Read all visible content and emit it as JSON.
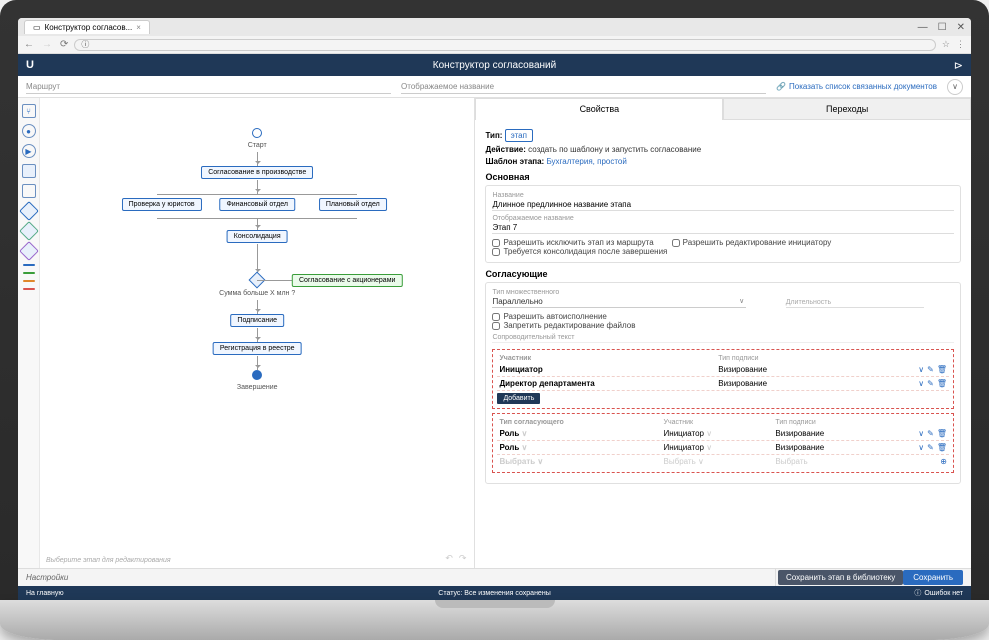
{
  "browser": {
    "tab_title": "Конструктор согласов...",
    "url": "",
    "win_min": "—",
    "win_max": "☐",
    "win_close": "✕"
  },
  "header": {
    "logo": "U",
    "title": "Конструктор согласований",
    "flow_icon": "⊳"
  },
  "subheader": {
    "field1": "Маршрут",
    "field2": "Отображаемое название",
    "link": "Показать список связанных документов",
    "collapse": "∨"
  },
  "flowchart": {
    "start": "Старт",
    "n1": "Согласование в производстве",
    "n2a": "Проверка у юристов",
    "n2b": "Финансовый отдел",
    "n2c": "Плановый отдел",
    "n3": "Консолидация",
    "gate": "Сумма больше X млн ?",
    "n4": "Согласование с акционерами",
    "n5": "Подписание",
    "n6": "Регистрация в реестре",
    "end": "Завершение",
    "hint": "Выберите этап для редактирования"
  },
  "tabs": {
    "props": "Свойства",
    "trans": "Переходы"
  },
  "props": {
    "type_label": "Тип:",
    "type_value": "этап",
    "action_label": "Действие:",
    "action_value": "создать по шаблону и запустить согласование",
    "tmpl_label": "Шаблон этапа:",
    "tmpl_value": "Бухгалтерия, простой",
    "section_main": "Основная",
    "name_label": "Название",
    "name_value": "Длинное предлинное название этапа",
    "disp_label": "Отображаемое название",
    "disp_value": "Этап 7",
    "chk1": "Разрешить исключить этап из маршрута",
    "chk2": "Разрешить редактирование инициатору",
    "chk3": "Требуется консолидация после завершения",
    "section_appr": "Согласующие",
    "mode_label": "Тип множественного",
    "mode_value": "Параллельно",
    "dur_label": "Длительность",
    "chk4": "Разрешить автоисполнение",
    "chk5": "Запретить редактирование файлов",
    "text_label": "Сопроводительный текст"
  },
  "table1": {
    "h1": "Участник",
    "h2": "Тип подписи",
    "r1c1": "Инициатор",
    "r1c2": "Визирование",
    "r2c1": "Директор департамента",
    "r2c2": "Визирование",
    "add": "Добавить"
  },
  "table2": {
    "h1": "Тип согласующего",
    "h2": "Участник",
    "h3": "Тип подписи",
    "r1c1": "Роль",
    "r1c2": "Инициатор",
    "r1c3": "Визирование",
    "r2c1": "Роль",
    "r2c2": "Инициатор",
    "r2c3": "Визирование",
    "r3": "Выбрать"
  },
  "footer": {
    "settings": "Настройки",
    "save_lib": "Сохранить этап в библиотеку",
    "save": "Сохранить"
  },
  "status": {
    "home": "На главную",
    "center": "Статус: Все изменения сохранены",
    "err": "Ошибок нет"
  }
}
